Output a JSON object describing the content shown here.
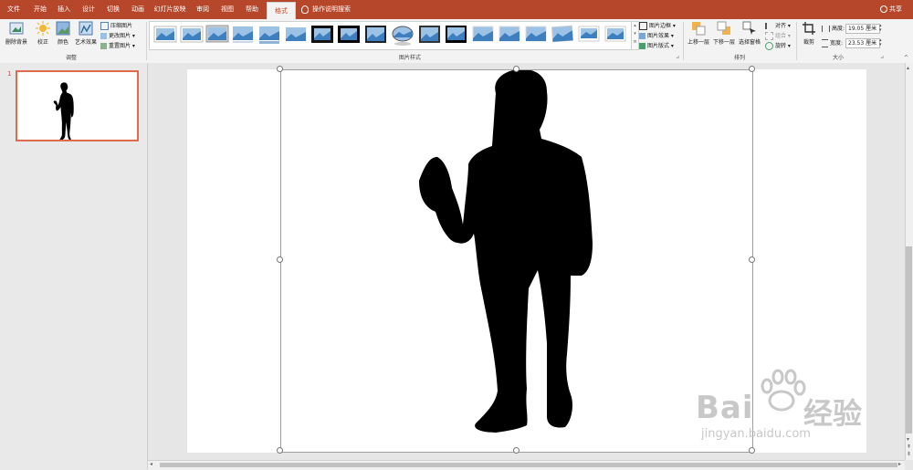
{
  "tabs": [
    {
      "label": "文件"
    },
    {
      "label": "开始"
    },
    {
      "label": "插入"
    },
    {
      "label": "设计"
    },
    {
      "label": "切换"
    },
    {
      "label": "动画"
    },
    {
      "label": "幻灯片放映"
    },
    {
      "label": "审阅"
    },
    {
      "label": "视图"
    },
    {
      "label": "帮助"
    },
    {
      "label": "格式"
    }
  ],
  "tell_me": "操作说明搜索",
  "share": "共享",
  "ribbon": {
    "adjust": {
      "remove_bg": "删除背景",
      "correct": "校正",
      "color": "颜色",
      "art_effect": "艺术效果",
      "compress": "压缩图片",
      "change": "更改图片",
      "reset": "重置图片",
      "group_label": "调整"
    },
    "styles": {
      "group_label": "图片样式",
      "border": "图片边框",
      "effect": "图片效果",
      "layout": "图片版式"
    },
    "arrange": {
      "bring_forward": "上移一层",
      "send_backward": "下移一层",
      "selection_pane": "选择窗格",
      "align": "对齐",
      "group": "组合",
      "rotate": "旋转",
      "group_label": "排列"
    },
    "size": {
      "crop": "裁剪",
      "height_label": "高度:",
      "height_value": "19.05 厘米",
      "width_label": "宽度:",
      "width_value": "23.53 厘米",
      "group_label": "大小"
    }
  },
  "slides_panel": {
    "slide_number": "1"
  },
  "watermark": {
    "brand": "Bai",
    "brand_cn": "经验",
    "url": "jingyan.baidu.com"
  },
  "colors": {
    "accent": "#b7472a",
    "selection": "#e06a4c"
  }
}
